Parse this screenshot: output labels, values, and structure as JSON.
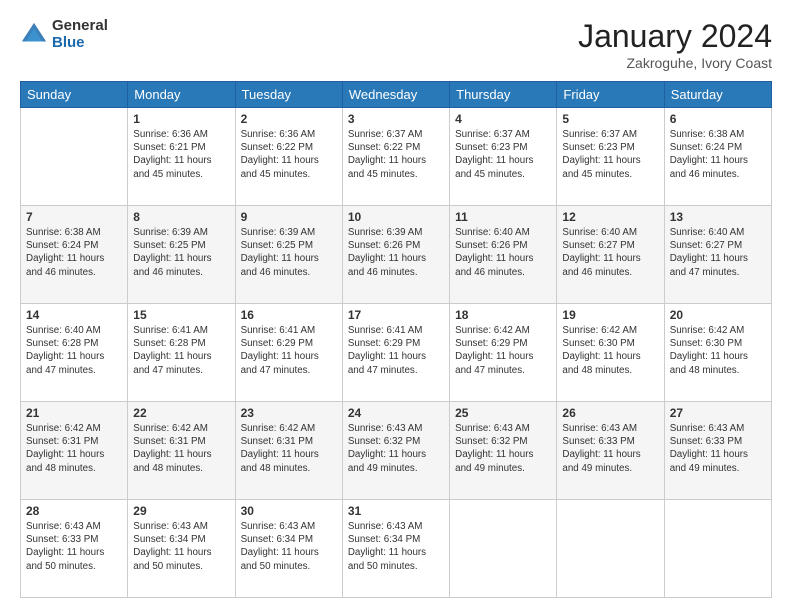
{
  "header": {
    "logo": {
      "general": "General",
      "blue": "Blue"
    },
    "title": "January 2024",
    "subtitle": "Zakroguhe, Ivory Coast"
  },
  "days_of_week": [
    "Sunday",
    "Monday",
    "Tuesday",
    "Wednesday",
    "Thursday",
    "Friday",
    "Saturday"
  ],
  "weeks": [
    [
      {
        "day": "",
        "sunrise": "",
        "sunset": "",
        "daylight": ""
      },
      {
        "day": "1",
        "sunrise": "Sunrise: 6:36 AM",
        "sunset": "Sunset: 6:21 PM",
        "daylight": "Daylight: 11 hours and 45 minutes."
      },
      {
        "day": "2",
        "sunrise": "Sunrise: 6:36 AM",
        "sunset": "Sunset: 6:22 PM",
        "daylight": "Daylight: 11 hours and 45 minutes."
      },
      {
        "day": "3",
        "sunrise": "Sunrise: 6:37 AM",
        "sunset": "Sunset: 6:22 PM",
        "daylight": "Daylight: 11 hours and 45 minutes."
      },
      {
        "day": "4",
        "sunrise": "Sunrise: 6:37 AM",
        "sunset": "Sunset: 6:23 PM",
        "daylight": "Daylight: 11 hours and 45 minutes."
      },
      {
        "day": "5",
        "sunrise": "Sunrise: 6:37 AM",
        "sunset": "Sunset: 6:23 PM",
        "daylight": "Daylight: 11 hours and 45 minutes."
      },
      {
        "day": "6",
        "sunrise": "Sunrise: 6:38 AM",
        "sunset": "Sunset: 6:24 PM",
        "daylight": "Daylight: 11 hours and 46 minutes."
      }
    ],
    [
      {
        "day": "7",
        "sunrise": "Sunrise: 6:38 AM",
        "sunset": "Sunset: 6:24 PM",
        "daylight": "Daylight: 11 hours and 46 minutes."
      },
      {
        "day": "8",
        "sunrise": "Sunrise: 6:39 AM",
        "sunset": "Sunset: 6:25 PM",
        "daylight": "Daylight: 11 hours and 46 minutes."
      },
      {
        "day": "9",
        "sunrise": "Sunrise: 6:39 AM",
        "sunset": "Sunset: 6:25 PM",
        "daylight": "Daylight: 11 hours and 46 minutes."
      },
      {
        "day": "10",
        "sunrise": "Sunrise: 6:39 AM",
        "sunset": "Sunset: 6:26 PM",
        "daylight": "Daylight: 11 hours and 46 minutes."
      },
      {
        "day": "11",
        "sunrise": "Sunrise: 6:40 AM",
        "sunset": "Sunset: 6:26 PM",
        "daylight": "Daylight: 11 hours and 46 minutes."
      },
      {
        "day": "12",
        "sunrise": "Sunrise: 6:40 AM",
        "sunset": "Sunset: 6:27 PM",
        "daylight": "Daylight: 11 hours and 46 minutes."
      },
      {
        "day": "13",
        "sunrise": "Sunrise: 6:40 AM",
        "sunset": "Sunset: 6:27 PM",
        "daylight": "Daylight: 11 hours and 47 minutes."
      }
    ],
    [
      {
        "day": "14",
        "sunrise": "Sunrise: 6:40 AM",
        "sunset": "Sunset: 6:28 PM",
        "daylight": "Daylight: 11 hours and 47 minutes."
      },
      {
        "day": "15",
        "sunrise": "Sunrise: 6:41 AM",
        "sunset": "Sunset: 6:28 PM",
        "daylight": "Daylight: 11 hours and 47 minutes."
      },
      {
        "day": "16",
        "sunrise": "Sunrise: 6:41 AM",
        "sunset": "Sunset: 6:29 PM",
        "daylight": "Daylight: 11 hours and 47 minutes."
      },
      {
        "day": "17",
        "sunrise": "Sunrise: 6:41 AM",
        "sunset": "Sunset: 6:29 PM",
        "daylight": "Daylight: 11 hours and 47 minutes."
      },
      {
        "day": "18",
        "sunrise": "Sunrise: 6:42 AM",
        "sunset": "Sunset: 6:29 PM",
        "daylight": "Daylight: 11 hours and 47 minutes."
      },
      {
        "day": "19",
        "sunrise": "Sunrise: 6:42 AM",
        "sunset": "Sunset: 6:30 PM",
        "daylight": "Daylight: 11 hours and 48 minutes."
      },
      {
        "day": "20",
        "sunrise": "Sunrise: 6:42 AM",
        "sunset": "Sunset: 6:30 PM",
        "daylight": "Daylight: 11 hours and 48 minutes."
      }
    ],
    [
      {
        "day": "21",
        "sunrise": "Sunrise: 6:42 AM",
        "sunset": "Sunset: 6:31 PM",
        "daylight": "Daylight: 11 hours and 48 minutes."
      },
      {
        "day": "22",
        "sunrise": "Sunrise: 6:42 AM",
        "sunset": "Sunset: 6:31 PM",
        "daylight": "Daylight: 11 hours and 48 minutes."
      },
      {
        "day": "23",
        "sunrise": "Sunrise: 6:42 AM",
        "sunset": "Sunset: 6:31 PM",
        "daylight": "Daylight: 11 hours and 48 minutes."
      },
      {
        "day": "24",
        "sunrise": "Sunrise: 6:43 AM",
        "sunset": "Sunset: 6:32 PM",
        "daylight": "Daylight: 11 hours and 49 minutes."
      },
      {
        "day": "25",
        "sunrise": "Sunrise: 6:43 AM",
        "sunset": "Sunset: 6:32 PM",
        "daylight": "Daylight: 11 hours and 49 minutes."
      },
      {
        "day": "26",
        "sunrise": "Sunrise: 6:43 AM",
        "sunset": "Sunset: 6:33 PM",
        "daylight": "Daylight: 11 hours and 49 minutes."
      },
      {
        "day": "27",
        "sunrise": "Sunrise: 6:43 AM",
        "sunset": "Sunset: 6:33 PM",
        "daylight": "Daylight: 11 hours and 49 minutes."
      }
    ],
    [
      {
        "day": "28",
        "sunrise": "Sunrise: 6:43 AM",
        "sunset": "Sunset: 6:33 PM",
        "daylight": "Daylight: 11 hours and 50 minutes."
      },
      {
        "day": "29",
        "sunrise": "Sunrise: 6:43 AM",
        "sunset": "Sunset: 6:34 PM",
        "daylight": "Daylight: 11 hours and 50 minutes."
      },
      {
        "day": "30",
        "sunrise": "Sunrise: 6:43 AM",
        "sunset": "Sunset: 6:34 PM",
        "daylight": "Daylight: 11 hours and 50 minutes."
      },
      {
        "day": "31",
        "sunrise": "Sunrise: 6:43 AM",
        "sunset": "Sunset: 6:34 PM",
        "daylight": "Daylight: 11 hours and 50 minutes."
      },
      {
        "day": "",
        "sunrise": "",
        "sunset": "",
        "daylight": ""
      },
      {
        "day": "",
        "sunrise": "",
        "sunset": "",
        "daylight": ""
      },
      {
        "day": "",
        "sunrise": "",
        "sunset": "",
        "daylight": ""
      }
    ]
  ]
}
